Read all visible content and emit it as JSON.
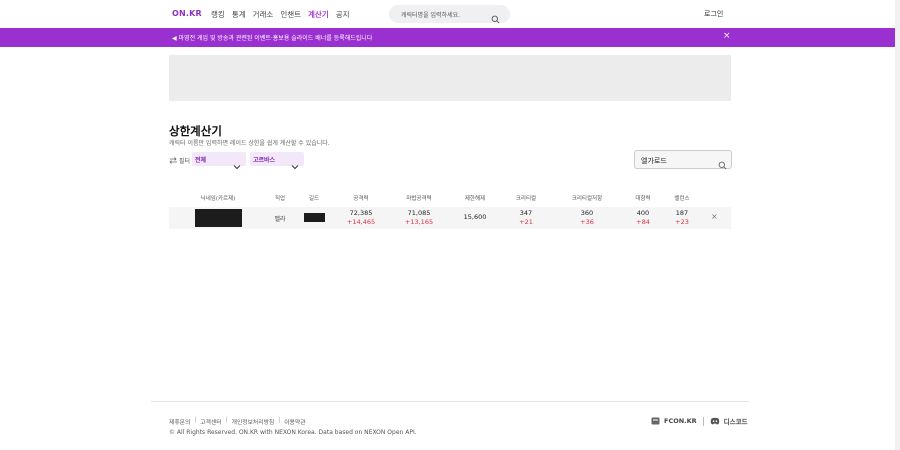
{
  "header": {
    "logo": "ON.KR",
    "nav": [
      "랭킹",
      "통계",
      "거래소",
      "인챈트",
      "계산기",
      "공지"
    ],
    "nav_active": "계산기",
    "search_placeholder": "캐릭터명을 입력하세요.",
    "login": "로그인"
  },
  "banner": {
    "text": "마영전 게임 및 방송과 관련된 이벤트·홍보용 슬라이드 배너를 등록해드립니다",
    "close": "×"
  },
  "page": {
    "title": "상한계산기",
    "subtitle": "캐릭터 이름만 입력하면 레이드 상한을 쉽게 계산할 수 있습니다.",
    "filter_label": "필터",
    "filter_job": "전체",
    "filter_raid": "고르바스",
    "guild_value": "엘가로드"
  },
  "table": {
    "headers": [
      "닉네임(카르제)",
      "직업",
      "길드",
      "공격력",
      "마법공격력",
      "제한해제",
      "크리티컬",
      "크리티컬저항",
      "대항력",
      "밸런스"
    ],
    "rows": [
      {
        "job": "벨라",
        "attack": "72,385",
        "attack_delta": "+14,465",
        "magic": "71,085",
        "magic_delta": "+13,165",
        "limit": "15,600",
        "crit": "347",
        "crit_delta": "+21",
        "crit_res": "360",
        "crit_res_delta": "+36",
        "resist": "400",
        "resist_delta": "+84",
        "balance": "187",
        "balance_delta": "+23",
        "remove": "×"
      }
    ]
  },
  "footer": {
    "links": [
      "제휴문의",
      "고객센터",
      "개인정보처리방침",
      "이용약관"
    ],
    "copyright": "© All Rights Reserved. ON.KR with NEXON Korea. Data based on NEXON Open API.",
    "fcon": "FCON.KR",
    "discord": "디스코드"
  },
  "colors": {
    "brand": "#9b30d0",
    "delta": "#e0303f"
  }
}
